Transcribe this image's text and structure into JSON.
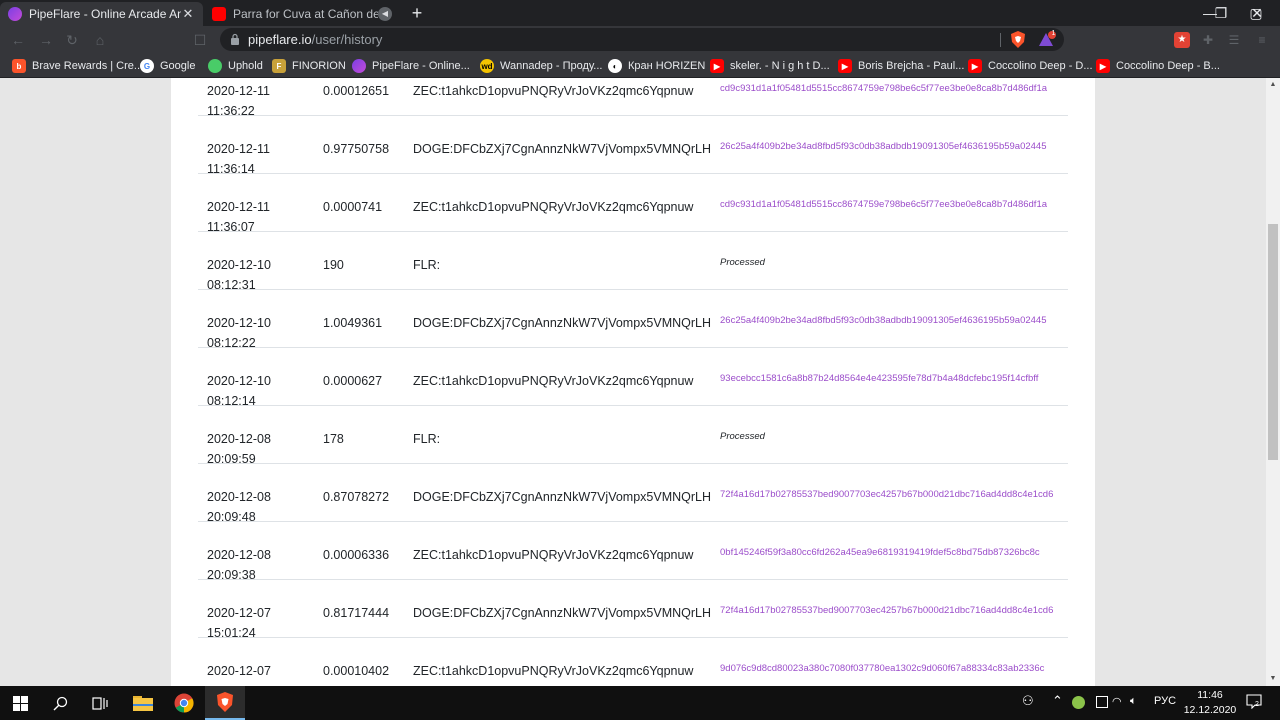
{
  "tabs": [
    {
      "title": "PipeFlare - Online Arcade And Ga",
      "active": true
    },
    {
      "title": "Parra for Cuva at Cañon del Sumid",
      "active": false
    }
  ],
  "address_bar": {
    "host": "pipeflare.io",
    "path": "/user/history"
  },
  "brave_rewards_badge": "1",
  "bookmarks": [
    {
      "label": "Brave Rewards | Cre...",
      "icon": "brave-lion-icon"
    },
    {
      "label": "Google",
      "icon": "google-icon"
    },
    {
      "label": "Uphold",
      "icon": "uphold-icon"
    },
    {
      "label": "FINORION",
      "icon": "finorion-icon"
    },
    {
      "label": "PipeFlare - Online...",
      "icon": "pipeflare-icon"
    },
    {
      "label": "Wannadep - Проду...",
      "icon": "wannadep-icon"
    },
    {
      "label": "Кран HORIZEN",
      "icon": "horizen-icon"
    },
    {
      "label": "skeler. - N i g h t D...",
      "icon": "youtube-icon"
    },
    {
      "label": "Boris Brejcha - Paul...",
      "icon": "youtube-icon"
    },
    {
      "label": "Coccolino Deep - D...",
      "icon": "youtube-icon"
    },
    {
      "label": "Coccolino Deep - B...",
      "icon": "youtube-icon"
    }
  ],
  "history": [
    {
      "date": "2020-12-11",
      "time": "11:36:22",
      "amount": "0.00012651",
      "address": "ZEC:t1ahkcD1opvuPNQRyVrJoVKz2qmc6Yqpnuw",
      "txid": "cd9c931d1a1f05481d5515cc8674759e798be6c5f77ee3be0e8ca8b7d486df1a"
    },
    {
      "date": "2020-12-11",
      "time": "11:36:14",
      "amount": "0.97750758",
      "address": "DOGE:DFCbZXj7CgnAnnzNkW7VjVompx5VMNQrLH",
      "txid": "26c25a4f409b2be34ad8fbd5f93c0db38adbdb19091305ef4636195b59a02445"
    },
    {
      "date": "2020-12-11",
      "time": "11:36:07",
      "amount": "0.0000741",
      "address": "ZEC:t1ahkcD1opvuPNQRyVrJoVKz2qmc6Yqpnuw",
      "txid": "cd9c931d1a1f05481d5515cc8674759e798be6c5f77ee3be0e8ca8b7d486df1a"
    },
    {
      "date": "2020-12-10",
      "time": "08:12:31",
      "amount": "190",
      "address": "FLR:",
      "txid": "Processed"
    },
    {
      "date": "2020-12-10",
      "time": "08:12:22",
      "amount": "1.0049361",
      "address": "DOGE:DFCbZXj7CgnAnnzNkW7VjVompx5VMNQrLH",
      "txid": "26c25a4f409b2be34ad8fbd5f93c0db38adbdb19091305ef4636195b59a02445"
    },
    {
      "date": "2020-12-10",
      "time": "08:12:14",
      "amount": "0.0000627",
      "address": "ZEC:t1ahkcD1opvuPNQRyVrJoVKz2qmc6Yqpnuw",
      "txid": "93ecebcc1581c6a8b87b24d8564e4e423595fe78d7b4a48dcfebc195f14cfbff"
    },
    {
      "date": "2020-12-08",
      "time": "20:09:59",
      "amount": "178",
      "address": "FLR:",
      "txid": "Processed"
    },
    {
      "date": "2020-12-08",
      "time": "20:09:48",
      "amount": "0.87078272",
      "address": "DOGE:DFCbZXj7CgnAnnzNkW7VjVompx5VMNQrLH",
      "txid": "72f4a16d17b02785537bed9007703ec4257b67b000d21dbc716ad4dd8c4e1cd6"
    },
    {
      "date": "2020-12-08",
      "time": "20:09:38",
      "amount": "0.00006336",
      "address": "ZEC:t1ahkcD1opvuPNQRyVrJoVKz2qmc6Yqpnuw",
      "txid": "0bf145246f59f3a80cc6fd262a45ea9e6819319419fdef5c8bd75db87326bc8c"
    },
    {
      "date": "2020-12-07",
      "time": "15:01:24",
      "amount": "0.81717444",
      "address": "DOGE:DFCbZXj7CgnAnnzNkW7VjVompx5VMNQrLH",
      "txid": "72f4a16d17b02785537bed9007703ec4257b67b000d21dbc716ad4dd8c4e1cd6"
    },
    {
      "date": "2020-12-07",
      "time": "15:01:13",
      "amount": "0.00010402",
      "address": "ZEC:t1ahkcD1opvuPNQRyVrJoVKz2qmc6Yqpnuw",
      "txid": "9d076c9d8cd80023a380c7080f037780ea1302c9d060f67a88334c83ab2336c"
    }
  ],
  "taskbar": {
    "language": "РУС",
    "time": "11:46",
    "date": "12.12.2020",
    "notification_count": "2"
  },
  "colors": {
    "txid_link": "#9b4dca",
    "browser_chrome": "#35363a",
    "page_background": "#e6e6e6"
  }
}
